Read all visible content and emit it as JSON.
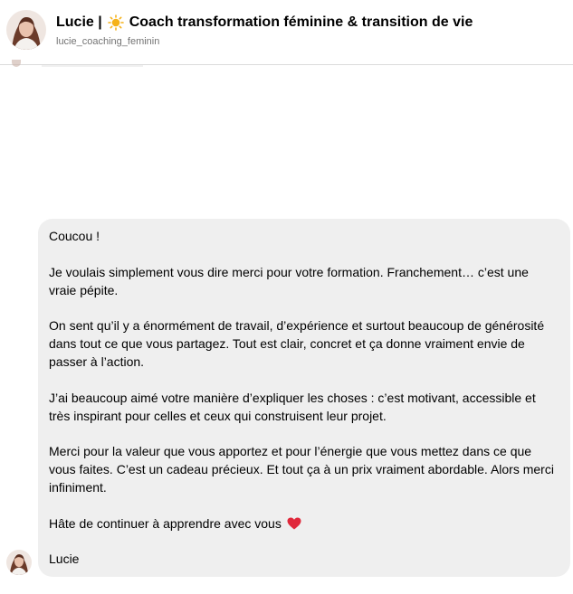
{
  "header": {
    "name": "Lucie |",
    "title": "Coach transformation féminine & transition de vie",
    "username": "lucie_coaching_feminin",
    "sun_emoji": "sun-emoji"
  },
  "message": {
    "greeting": "Coucou !",
    "paragraph_1": "Je voulais simplement vous dire merci pour votre formation. Franchement… c’est une vraie pépite.",
    "paragraph_2": "On sent qu’il y a énormément de travail, d’expérience et surtout beaucoup de générosité dans tout ce que vous partagez. Tout est clair, concret et ça donne vraiment envie de passer à l’action.",
    "paragraph_3": "J’ai beaucoup aimé votre manière d’expliquer les choses : c’est motivant, accessible et très inspirant pour celles et ceux qui construisent leur projet.",
    "paragraph_4": "Merci pour la valeur que vous apportez et pour l’énergie que vous mettez dans ce que vous faites. C’est un cadeau précieux. Et tout ça à un prix vraiment abordable. Alors merci infiniment.",
    "closing": "Hâte de continuer à apprendre avec vous",
    "heart_icon": "red-heart-emoji",
    "signature": "Lucie"
  },
  "colors": {
    "bubble_background": "#efefef",
    "heart": "#e0283b",
    "sun": "#f5b21a",
    "username_gray": "#737373"
  }
}
